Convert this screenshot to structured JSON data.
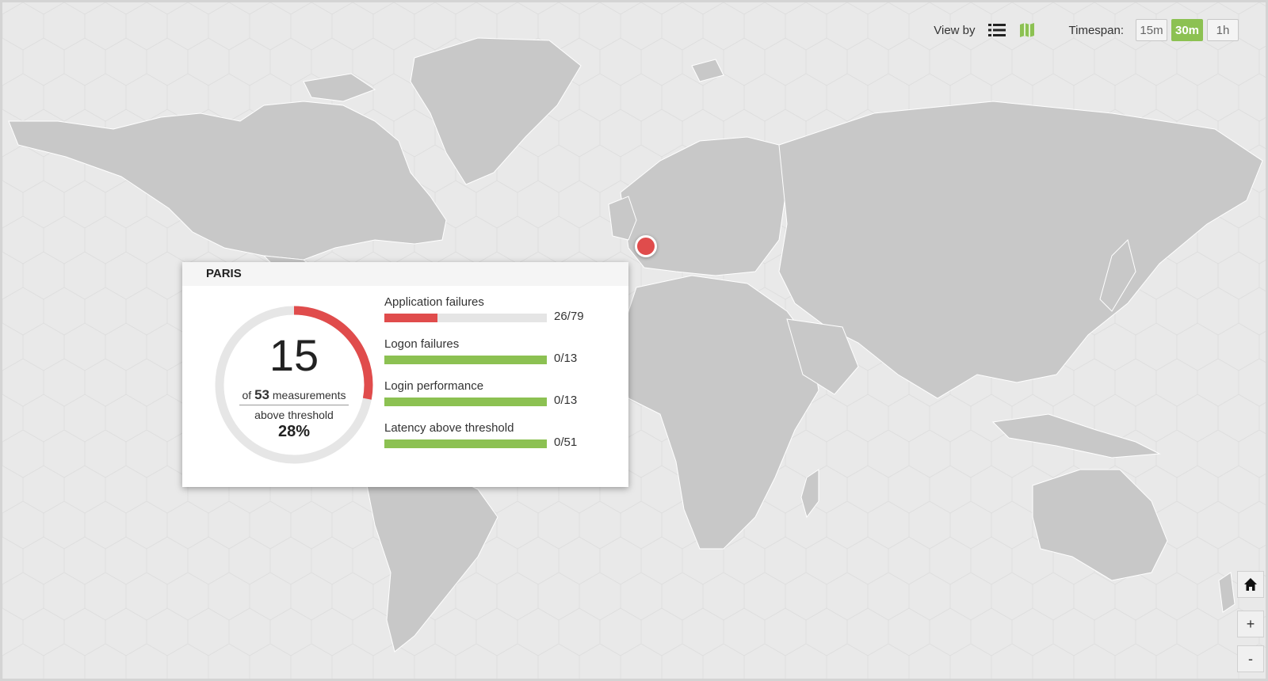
{
  "toolbar": {
    "view_by_label": "View by",
    "view_icons": [
      "list-icon",
      "map-icon"
    ],
    "timespan_label": "Timespan:",
    "timespan_options": [
      "15m",
      "30m",
      "1h"
    ],
    "timespan_selected": "30m"
  },
  "popup": {
    "location": "PARIS",
    "gauge": {
      "count": "15",
      "of_prefix": "of",
      "total": "53",
      "total_suffix": "measurements",
      "above_label": "above threshold",
      "percent": "28%",
      "fraction": 0.28
    },
    "metrics": [
      {
        "name": "Application failures",
        "value": "26/79",
        "fraction": 0.329,
        "color": "#e04c4c"
      },
      {
        "name": "Logon failures",
        "value": "0/13",
        "fraction": 1.0,
        "color": "#8cc152"
      },
      {
        "name": "Login performance",
        "value": "0/13",
        "fraction": 1.0,
        "color": "#8cc152"
      },
      {
        "name": "Latency above threshold",
        "value": "0/51",
        "fraction": 1.0,
        "color": "#8cc152"
      }
    ]
  },
  "map_controls": {
    "home": "home-icon",
    "zoom_in": "+",
    "zoom_out": "-"
  },
  "colors": {
    "accent_green": "#8cc152",
    "alert_red": "#e04c4c",
    "land": "#c8c8c8",
    "sea": "#e9e9e9"
  }
}
